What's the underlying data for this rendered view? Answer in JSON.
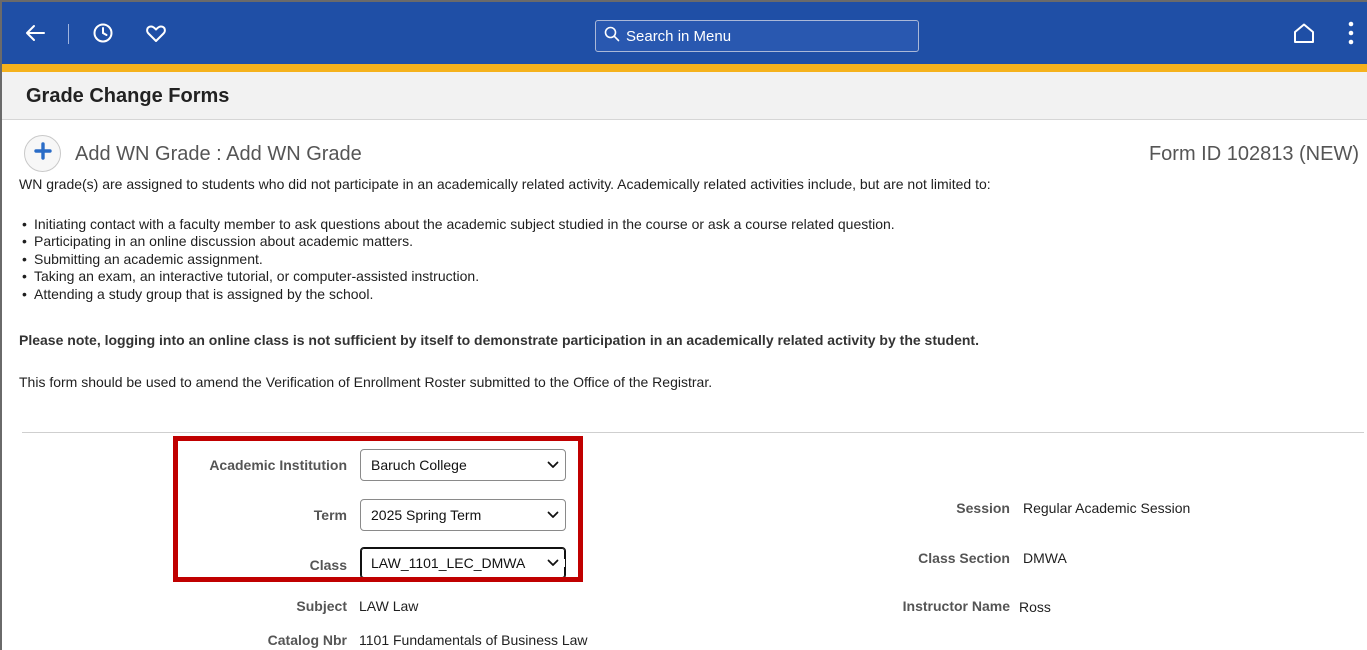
{
  "nav": {
    "search_placeholder": "Search in Menu",
    "icons": [
      "back-arrow-icon",
      "history-clock-icon",
      "favorites-heart-icon",
      "search-icon",
      "home-icon",
      "more-vertical-icon"
    ]
  },
  "page": {
    "title": "Grade Change Forms"
  },
  "form": {
    "heading": "Add WN Grade : Add WN Grade",
    "form_id": "Form ID 102813 (NEW)",
    "intro": "WN grade(s) are assigned to students who did not participate in an academically related activity.  Academically related activities include, but are not limited to:",
    "bullets": [
      "Initiating contact with a faculty member to ask questions about the academic subject studied in the course or ask a course related question.",
      "Participating in an online discussion about academic matters.",
      "Submitting an academic assignment.",
      "Taking an exam, an interactive tutorial, or computer-assisted instruction.",
      "Attending a study group that is assigned by the school."
    ],
    "note_bold": "Please note, logging into an online class is not sufficient by itself to demonstrate participation in an academically related activity by the student.",
    "note_plain": "This form should be used to amend the Verification of Enrollment Roster submitted to the Office of the Registrar."
  },
  "fields": {
    "institution": {
      "label": "Academic Institution",
      "value": "Baruch College"
    },
    "term": {
      "label": "Term",
      "value": "2025 Spring Term"
    },
    "class": {
      "label": "Class",
      "value": "LAW_1101_LEC_DMWA"
    },
    "subject": {
      "label": "Subject",
      "value": "LAW Law"
    },
    "catalog": {
      "label": "Catalog Nbr",
      "value": "1101 Fundamentals of Business Law"
    },
    "session": {
      "label": "Session",
      "value": "Regular Academic Session"
    },
    "class_section": {
      "label": "Class Section",
      "value": "DMWA"
    },
    "instructor": {
      "label": "Instructor Name",
      "value": "Ross"
    }
  },
  "colors": {
    "nav_bar": "#1f4fa6",
    "nav_stripe": "#f5b21d",
    "highlight_box": "#c00000",
    "add_icon": "#2a6cc7"
  }
}
